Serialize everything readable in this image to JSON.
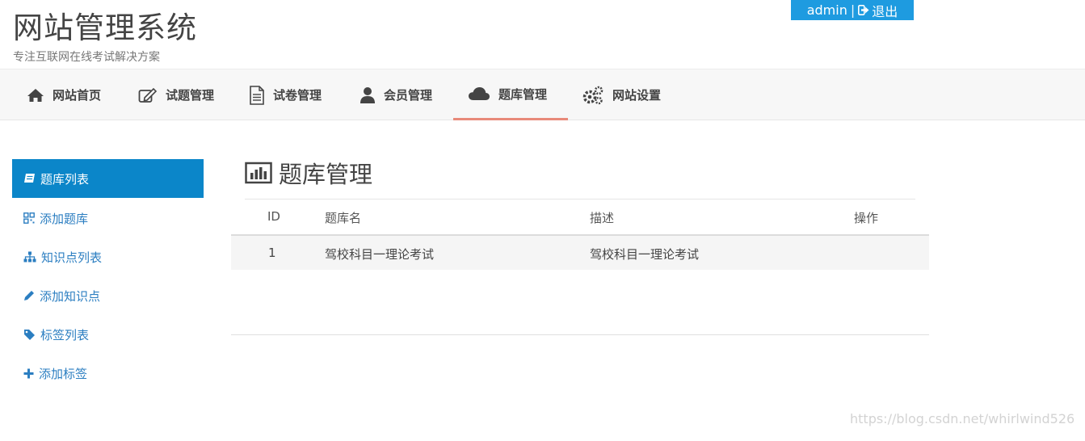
{
  "header": {
    "title": "网站管理系统",
    "subtitle": "专注互联网在线考试解决方案",
    "username": "admin",
    "separator": "|",
    "logout_label": "退出"
  },
  "nav": {
    "items": [
      {
        "label": "网站首页",
        "icon": "home-icon"
      },
      {
        "label": "试题管理",
        "icon": "edit-icon"
      },
      {
        "label": "试卷管理",
        "icon": "document-icon"
      },
      {
        "label": "会员管理",
        "icon": "user-icon"
      },
      {
        "label": "题库管理",
        "icon": "cloud-icon",
        "active": true
      },
      {
        "label": "网站设置",
        "icon": "gears-icon"
      }
    ],
    "active_color": "#e88a7a"
  },
  "sidebar": {
    "items": [
      {
        "label": "题库列表",
        "icon": "book-icon",
        "active": true
      },
      {
        "label": "添加题库",
        "icon": "qrcode-icon"
      },
      {
        "label": "知识点列表",
        "icon": "sitemap-icon"
      },
      {
        "label": "添加知识点",
        "icon": "pencil-icon"
      },
      {
        "label": "标签列表",
        "icon": "tag-icon"
      },
      {
        "label": "添加标签",
        "icon": "plus-icon"
      }
    ],
    "active_color": "#0b86c9",
    "link_color": "#2b7ec1"
  },
  "main": {
    "title": "题库管理",
    "title_icon": "bar-chart-icon",
    "table": {
      "columns": [
        "ID",
        "题库名",
        "描述",
        "操作"
      ],
      "rows": [
        {
          "id": "1",
          "name": "驾校科目一理论考试",
          "description": "驾校科目一理论考试",
          "actions": ""
        }
      ]
    }
  },
  "watermark": "https://blog.csdn.net/whirlwind526"
}
